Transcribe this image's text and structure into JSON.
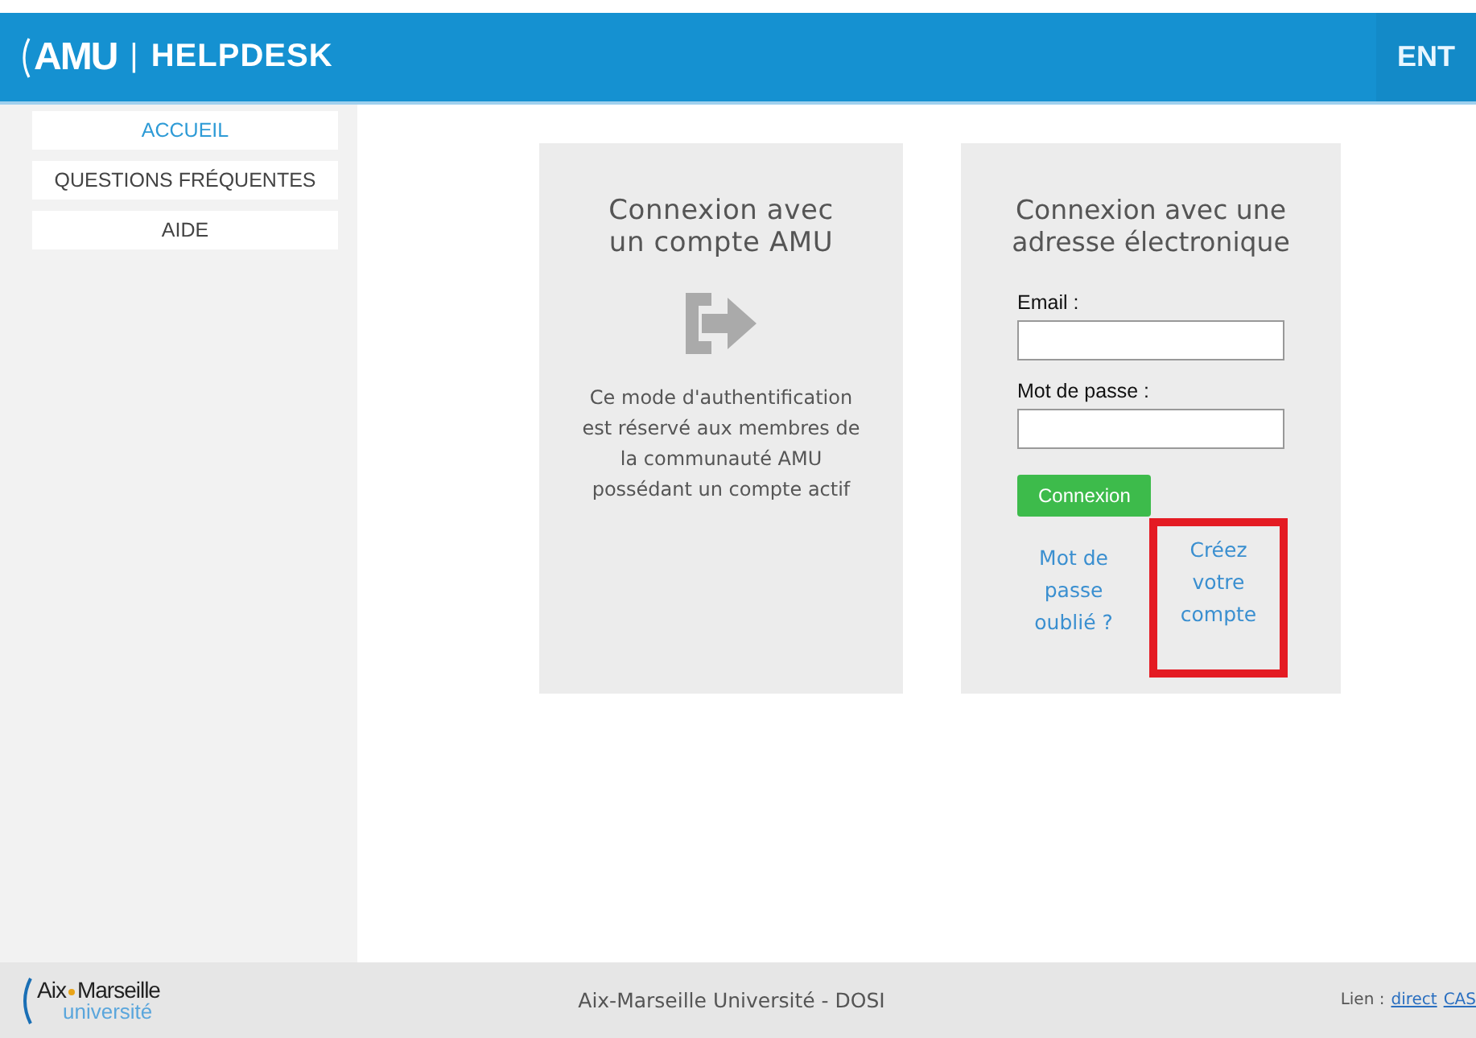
{
  "header": {
    "logo_mark": "AMU",
    "logo_sep": "|",
    "title": "HELPDESK",
    "ent_link": "ENT"
  },
  "sidebar": {
    "items": [
      {
        "label": "ACCUEIL",
        "selected": true
      },
      {
        "label": "QUESTIONS FRÉQUENTES",
        "selected": false
      },
      {
        "label": "AIDE",
        "selected": false
      }
    ]
  },
  "cards": [
    {
      "kind": "cas",
      "title": "Connexion avec un compte AMU",
      "description": "Ce mode d'authentification est réservé aux membres de la communauté AMU possédant un compte actif"
    },
    {
      "kind": "form",
      "title": "Connexion avec une adresse électronique",
      "fields": [
        {
          "label": "Email :"
        },
        {
          "label": "Mot de passe :"
        }
      ],
      "submit": "Connexion",
      "links": [
        {
          "label": "Mot de passe oublié ?",
          "highlighted": false
        },
        {
          "label": "Créez votre compte",
          "highlighted": true
        }
      ]
    }
  ],
  "footer": {
    "logo": {
      "word1": "Aix",
      "word2": "Marseille",
      "word3": "université"
    },
    "center": "Aix-Marseille Université - DOSI",
    "links_label": "Lien :",
    "links": [
      "direct",
      "CAS"
    ]
  }
}
